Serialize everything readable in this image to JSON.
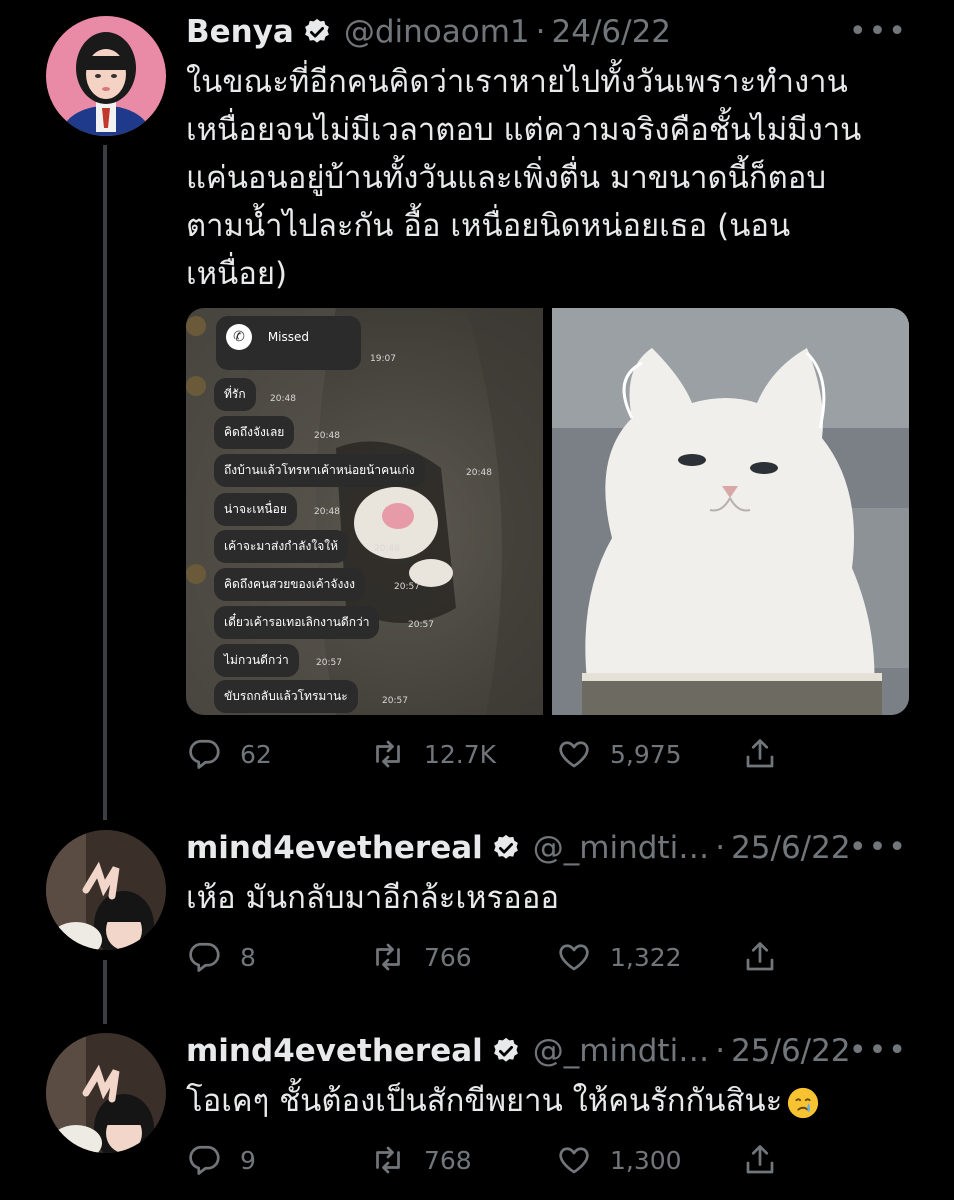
{
  "tweets": [
    {
      "name": "Benya",
      "handle": "@dinoaom1",
      "dot": "·",
      "date": "24/6/22",
      "more": "•••",
      "text_lines": [
        "ในขณะที่อีกคนคิดว่าเราหายไปทั้งวันเพราะทำงาน",
        "เหนื่อยจนไม่มีเวลาตอบ แต่ความจริงคือชั้นไม่มีงาน",
        "แค่นอนอยู่บ้านทั้งวันและเพิ่งตื่น มาขนาดนี้ก็ตอบ",
        "ตามน้ำไปละกัน อื้อ เหนื่อยนิดหน่อยเธอ (นอน",
        "เหนื่อย)"
      ],
      "replies": "62",
      "retweets": "12.7K",
      "likes": "5,975"
    },
    {
      "name": "mind4evethereal",
      "handle": "@_mindti…",
      "dot": "·",
      "date": "25/6/22",
      "more": "•••",
      "text": "เห้อ มันกลับมาอีกล้ะเหรอออ",
      "replies": "8",
      "retweets": "766",
      "likes": "1,322"
    },
    {
      "name": "mind4evethereal",
      "handle": "@_mindti…",
      "dot": "·",
      "date": "25/6/22",
      "more": "•••",
      "text": "โอเคๆ ชั้นต้องเป็นสักขีพยาน ให้คนรักกันสินะ",
      "emoji": "crying-face",
      "replies": "9",
      "retweets": "768",
      "likes": "1,300"
    }
  ],
  "chat": {
    "missed_label": "Missed",
    "missed_time": "19:07",
    "messages": [
      {
        "text": "ที่รัก",
        "time": "20:48"
      },
      {
        "text": "คิดถึงจังเลย",
        "time": "20:48"
      },
      {
        "text": "ถึงบ้านแล้วโทรหาเค้าหน่อยน้าคนเก่ง",
        "time": "20:48"
      },
      {
        "text": "น่าจะเหนื่อย",
        "time": "20:48"
      },
      {
        "text": "เค้าจะมาส่งกำลังใจให้",
        "time": "20:48"
      },
      {
        "text": "คิดถึงคนสวยของเค้าจังงง",
        "time": "20:57"
      },
      {
        "text": "เดี๋ยวเค้ารอเทอเลิกงานดีกว่า",
        "time": "20:57"
      },
      {
        "text": "ไม่กวนดีกว่า",
        "time": "20:57"
      },
      {
        "text": "ขับรถกลับแล้วโทรมานะ",
        "time": "20:57"
      }
    ]
  },
  "colors": {
    "background": "#000000",
    "text_primary": "#e7e9ea",
    "text_secondary": "#71767b",
    "thread_line": "#3a3d42"
  },
  "icons": [
    "verified-badge-icon",
    "reply-icon",
    "retweet-icon",
    "like-icon",
    "share-icon",
    "more-icon"
  ]
}
